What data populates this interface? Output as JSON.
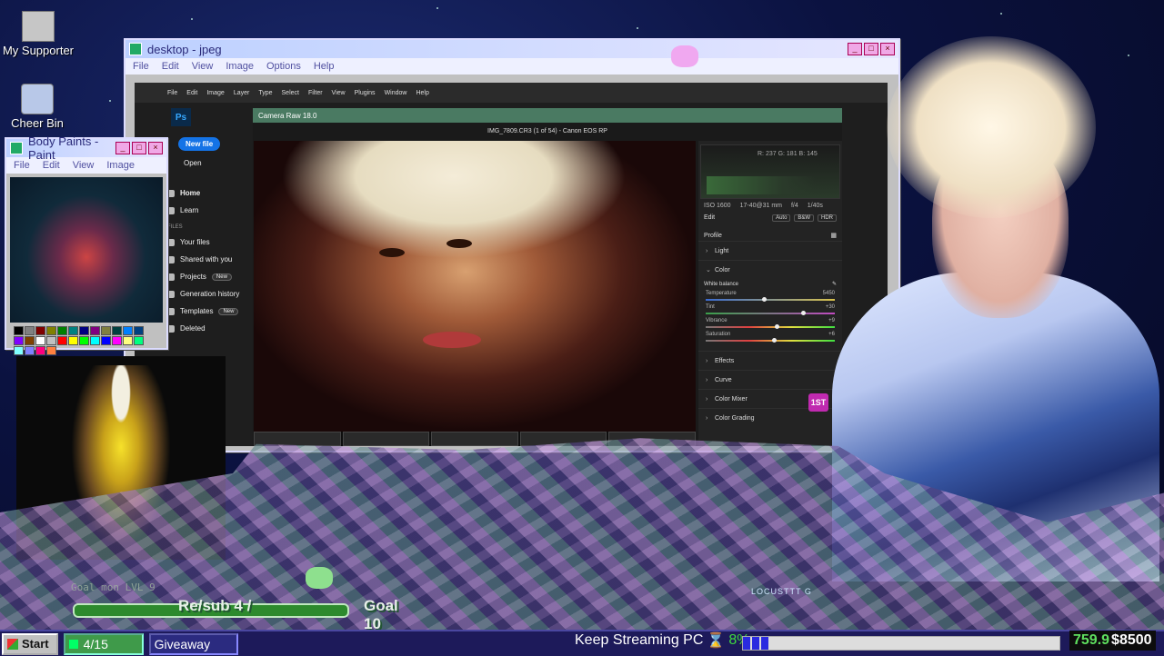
{
  "desktop": {
    "icons": [
      {
        "label": "My Supporter",
        "icon": "computer-icon"
      },
      {
        "label": "Cheer Bin",
        "icon": "recycle-bin-icon"
      }
    ]
  },
  "jpeg_window": {
    "title": "desktop - jpeg",
    "menu": [
      "File",
      "Edit",
      "View",
      "Image",
      "Options",
      "Help"
    ]
  },
  "photoshop": {
    "menu": [
      "File",
      "Edit",
      "Image",
      "Layer",
      "Type",
      "Select",
      "Filter",
      "View",
      "Plugins",
      "Window",
      "Help"
    ],
    "logo": "Ps",
    "new_file": "New file",
    "open": "Open",
    "nav": [
      {
        "label": "Home",
        "badge": ""
      },
      {
        "label": "Learn",
        "badge": ""
      }
    ],
    "files_header": "FILES",
    "files": [
      {
        "label": "Your files",
        "badge": ""
      },
      {
        "label": "Shared with you",
        "badge": ""
      },
      {
        "label": "Projects",
        "badge": "New"
      },
      {
        "label": "Generation history",
        "badge": ""
      },
      {
        "label": "Templates",
        "badge": "New"
      },
      {
        "label": "Deleted",
        "badge": ""
      }
    ]
  },
  "camera_raw": {
    "title": "Camera Raw 18.0",
    "file_info": "IMG_7809.CR3 (1 of 54)  -  Canon EOS RP",
    "histogram_readout": "R: 237   G: 181   B: 145",
    "camera": {
      "iso": "ISO 1600",
      "lens": "17-40@31 mm",
      "aperture": "f/4",
      "shutter": "1/40s"
    },
    "edit_label": "Edit",
    "edit_buttons": [
      "Auto",
      "B&W",
      "HDR"
    ],
    "profile_label": "Profile",
    "sections_top": [
      "Light",
      "Color"
    ],
    "white_balance": "White balance",
    "sliders": [
      {
        "label": "Temperature",
        "value": "5450",
        "position": 0.45
      },
      {
        "label": "Tint",
        "value": "+30",
        "position": 0.75
      },
      {
        "label": "Vibrance",
        "value": "+9",
        "position": 0.55
      },
      {
        "label": "Saturation",
        "value": "+6",
        "position": 0.53
      }
    ],
    "sections_bottom": [
      "Effects",
      "Curve",
      "Color Mixer",
      "Color Grading"
    ]
  },
  "paint_window": {
    "title": "Body Paints - Paint",
    "menu": [
      "File",
      "Edit",
      "View",
      "Image"
    ],
    "palette": [
      "#000000",
      "#808080",
      "#800000",
      "#808000",
      "#008000",
      "#008080",
      "#000080",
      "#800080",
      "#808040",
      "#004040",
      "#0080ff",
      "#004080",
      "#8000ff",
      "#804000",
      "#ffffff",
      "#c0c0c0",
      "#ff0000",
      "#ffff00",
      "#00ff00",
      "#00ffff",
      "#0000ff",
      "#ff00ff",
      "#ffff80",
      "#00ff80",
      "#80ffff",
      "#8080ff",
      "#ff0080",
      "#ff8040"
    ]
  },
  "overlay": {
    "goal_ghost": "Goal  mon LVL 9",
    "resub": "Re/sub 4 /",
    "goal": "Goal 10",
    "locust": "LOCUSTTT G",
    "first_badge": "1ST"
  },
  "taskbar": {
    "start": "Start",
    "count": "4/15",
    "giveaway": "Giveaway",
    "keep_streaming": "Keep Streaming PC",
    "hourglass": "⌛",
    "percent": "8%",
    "progress": 0.08,
    "money_current": "759.9",
    "money_goal": "$8500"
  },
  "colors": {
    "accent": "#4a7a62",
    "ps_blue": "#1473e6",
    "taskbar": "#1d1a5a"
  }
}
